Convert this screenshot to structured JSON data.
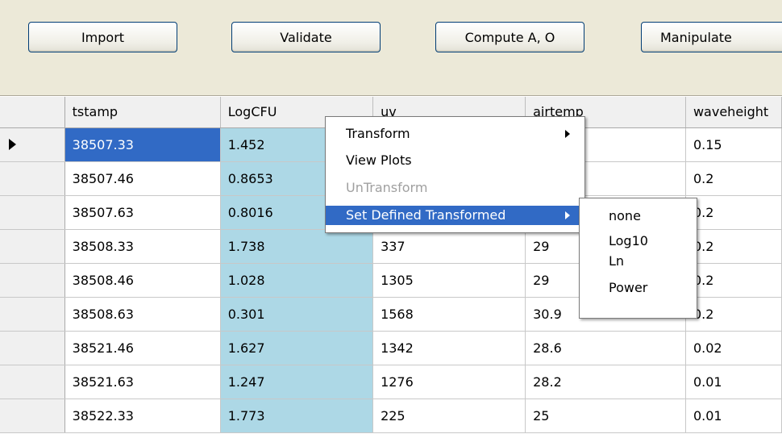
{
  "toolbar": {
    "buttons": [
      "Import",
      "Validate",
      "Compute A, O",
      "Manipulate"
    ]
  },
  "table": {
    "columns": [
      "tstamp",
      "LogCFU",
      "uv",
      "airtemp",
      "waveheight"
    ],
    "rows": [
      [
        "38507.33",
        "1.452",
        "",
        "",
        "0.15"
      ],
      [
        "38507.46",
        "0.8653",
        "",
        "",
        "0.2"
      ],
      [
        "38507.63",
        "0.8016",
        "",
        "",
        "0.2"
      ],
      [
        "38508.33",
        "1.738",
        "337",
        "29",
        "0.2"
      ],
      [
        "38508.46",
        "1.028",
        "1305",
        "29",
        "0.2"
      ],
      [
        "38508.63",
        "0.301",
        "1568",
        "30.9",
        "0.2"
      ],
      [
        "38521.46",
        "1.627",
        "1342",
        "28.6",
        "0.02"
      ],
      [
        "38521.63",
        "1.247",
        "1276",
        "28.2",
        "0.01"
      ],
      [
        "38522.33",
        "1.773",
        "225",
        "25",
        "0.01"
      ]
    ],
    "current_row_indicator": "arrow-right-icon"
  },
  "context_menu": {
    "items": [
      {
        "label": "Transform",
        "submenu": true,
        "enabled": true
      },
      {
        "label": "View Plots",
        "submenu": false,
        "enabled": true
      },
      {
        "label": "UnTransform",
        "submenu": false,
        "enabled": false
      },
      {
        "label": "Set Defined Transformed",
        "submenu": true,
        "enabled": true,
        "highlighted": true
      }
    ],
    "submenu_items": [
      "none",
      "Log10",
      "Ln",
      "Power"
    ]
  },
  "colors": {
    "toolbar_bg": "#ece9d8",
    "selected_cell": "#316ac5",
    "logcfu_column": "#add8e6",
    "menu_highlight": "#316ac5"
  }
}
